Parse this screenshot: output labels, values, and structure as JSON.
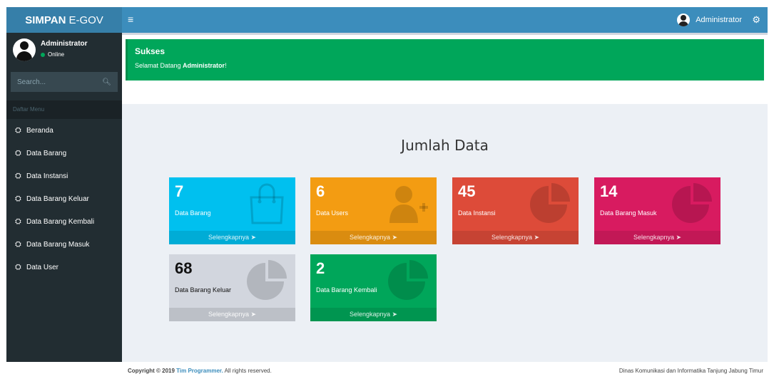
{
  "header": {
    "logo_bold": "SIMPAN",
    "logo_rest": "E-GOV",
    "toggle_icon": "menu-icon",
    "user_name": "Administrator"
  },
  "sidebar": {
    "user_name": "Administrator",
    "status": "Online",
    "search_placeholder": "Search...",
    "menu_header": "Daftar Menu",
    "items": [
      {
        "label": "Beranda"
      },
      {
        "label": "Data Barang"
      },
      {
        "label": "Data Instansi"
      },
      {
        "label": "Data Barang Keluar"
      },
      {
        "label": "Data Barang Kembali"
      },
      {
        "label": "Data Barang Masuk"
      },
      {
        "label": "Data User"
      }
    ]
  },
  "alert": {
    "title": "Sukses",
    "prefix": "Selamat Datang ",
    "name": "Administrator",
    "suffix": "!"
  },
  "main": {
    "heading": "Jumlah Data",
    "boxes": [
      {
        "value": "7",
        "label": "Data Barang",
        "link": "Selengkapnya",
        "color": "#00c0ef",
        "icon": "shopping-bag-icon"
      },
      {
        "value": "6",
        "label": "Data Users",
        "link": "Selengkapnya",
        "color": "#f39c12",
        "icon": "user-plus-icon"
      },
      {
        "value": "45",
        "label": "Data Instansi",
        "link": "Selengkapnya",
        "color": "#dd4b39",
        "icon": "pie-chart-icon"
      },
      {
        "value": "14",
        "label": "Data Barang Masuk",
        "link": "Selengkapnya",
        "color": "#d81b60",
        "icon": "pie-chart-icon"
      },
      {
        "value": "68",
        "label": "Data Barang Keluar",
        "link": "Selengkapnya",
        "color": "#d2d6de",
        "icon": "pie-chart-icon"
      },
      {
        "value": "2",
        "label": "Data Barang Kembali",
        "link": "Selengkapnya",
        "color": "#00a65a",
        "icon": "pie-chart-icon"
      }
    ]
  },
  "footer": {
    "copyright_prefix": "Copyright © 2019 ",
    "team": "Tim Programmer.",
    "rights": " All rights reserved.",
    "right_text": "Dinas Komunikasi dan Informatika Tanjung Jabung Timur"
  }
}
